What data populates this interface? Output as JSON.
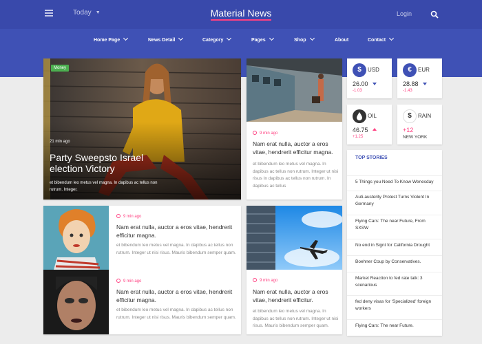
{
  "header": {
    "menu_icon": "hamburger-icon",
    "date_label": "Today",
    "logo": "Material News",
    "login": "Login",
    "search_icon": "search-icon"
  },
  "nav": [
    "Home Page",
    "News Detail",
    "Category",
    "Pages",
    "Shop",
    "About",
    "Contact"
  ],
  "hero": {
    "tag": "Money",
    "time": "21 min ago",
    "title": "Party Sweepsto Israel election Victory",
    "excerpt": "et bibendum leo metus vel magna. In dapibus ac tellus non rutrum. Integer."
  },
  "article_top": {
    "time": "9 min ago",
    "title": "Nam erat nulla, auctor a eros vitae, hendrerit efficitur magna.",
    "excerpt": "et bibendum leo metus vel magna. In dapibus ac tellus non rutrum. Integer ut nisi risus In dapibus ac tellus non rutrum. In dapibus ac tellus"
  },
  "article_mid1": {
    "time": "9 min ago",
    "title": "Nam erat nulla, auctor a eros vitae, hendrerit efficitur magna.",
    "excerpt": "et bibendum leo metus vel magna. In dapibus ac tellus non rutrum. Integer ut nisi risus. Mauris bibendum semper quam."
  },
  "article_mid2": {
    "time": "9 min ago",
    "title": "Nam erat nulla, auctor a eros vitae, hendrerit efficitur magna.",
    "excerpt": "et bibendum leo metus vel magna. In dapibus ac tellus non rutrum. Integer ut nisi risus. Mauris bibendum semper quam."
  },
  "article_mid3": {
    "time": "9 min ago",
    "title": "Nam erat nulla, auctor a eros vitae, hendrerit efficitur.",
    "excerpt": "et bibendum leo metus vel magna. In dapibus ac tellus non rutrum. Integer ut nisi risus. Mauris bibendum semper quam."
  },
  "markets": {
    "usd": {
      "label": "USD",
      "symbol": "$",
      "value": "26.00",
      "change": "-1.03",
      "direction": "down"
    },
    "eur": {
      "label": "EUR",
      "symbol": "€",
      "value": "28.88",
      "change": "-1.43",
      "direction": "down"
    },
    "oil": {
      "label": "OIL",
      "symbol": "drop-icon",
      "value": "46.75",
      "change": "+1.25",
      "direction": "up"
    },
    "rain": {
      "label": "RAIN",
      "symbol": "$",
      "value": "+12",
      "location": "NEW YORK"
    }
  },
  "top_stories": {
    "title": "TOP STORIES",
    "items": [
      "5 Things you Need To Know Wenesday",
      "Auti-austerity Protest Turns Violent In Germany",
      "Flying Cars: The near Future, From SXSW",
      "No end in Signt for California Drought",
      "Boehner Coup by Conservatives.",
      "Market Reaction to fed rate talk: 3 scenarious",
      "fed deny visas for 'Specialized' foreign workers",
      "Flying Cars: The near Future."
    ]
  },
  "colors": {
    "primary": "#3f51b5",
    "header": "#3949ab",
    "accent": "#ff4081",
    "tag_green": "#4caf50",
    "background": "#ececec"
  }
}
